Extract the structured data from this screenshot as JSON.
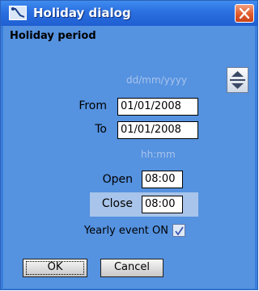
{
  "window": {
    "title": "Holiday dialog"
  },
  "group": {
    "header": "Holiday period"
  },
  "date_hint": "dd/mm/yyyy",
  "time_hint": "hh:mm",
  "fields": {
    "from_label": "From",
    "from_value": "01/01/2008",
    "to_label": "To",
    "to_value": "01/01/2008",
    "open_label": "Open",
    "open_value": "08:00",
    "close_label": "Close",
    "close_value": "08:00"
  },
  "yearly": {
    "label": "Yearly event ON",
    "checked": true
  },
  "buttons": {
    "ok": "OK",
    "cancel": "Cancel"
  },
  "colors": {
    "titlebar": "#2a6fe0",
    "client_bg": "#5592e0",
    "close_button": "#e05b2a",
    "hint_text": "#a9c4ec"
  }
}
